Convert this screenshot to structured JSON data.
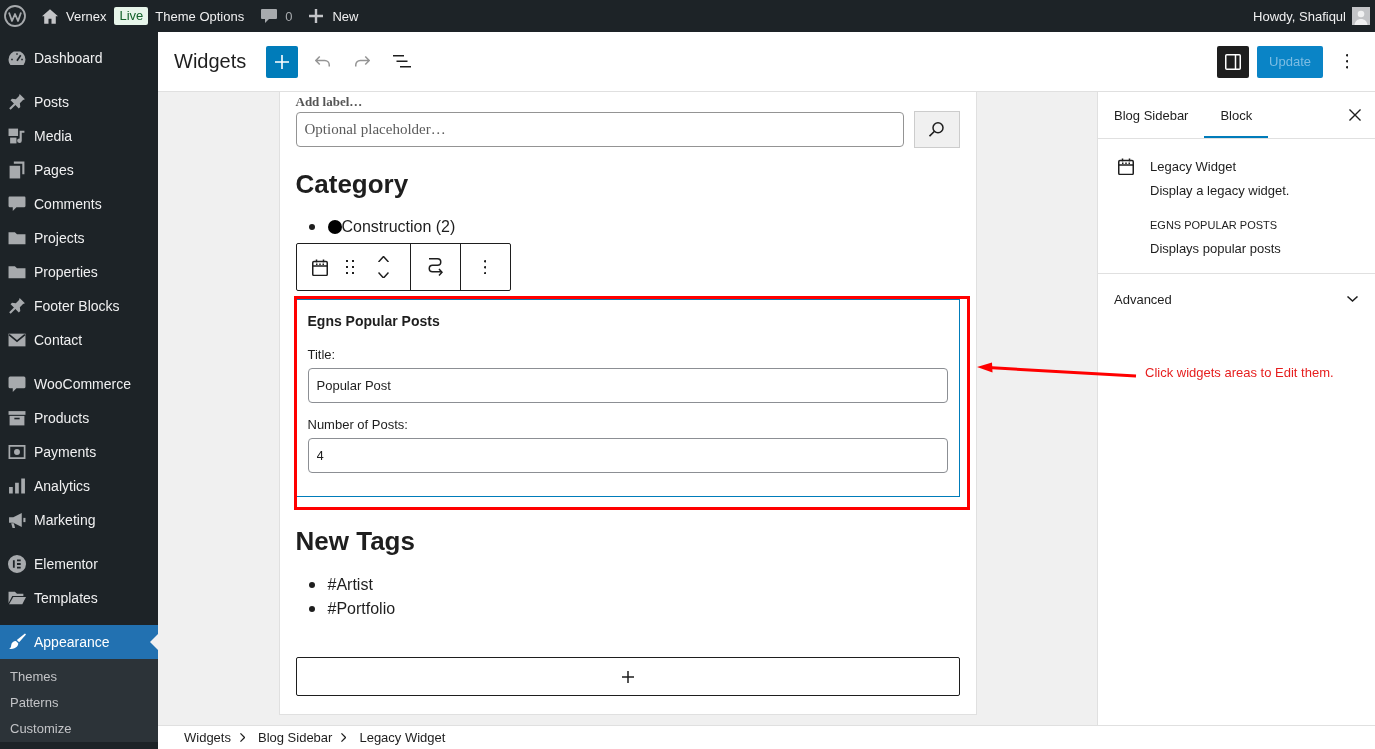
{
  "admin_bar": {
    "site_name": "Vernex",
    "badge": "Live",
    "menu_link": "Theme Options",
    "comment_count": "0",
    "new_label": "New",
    "greeting": "Howdy, Shafiqul"
  },
  "sidebar": {
    "groups": [
      {
        "items": [
          {
            "label": "Dashboard",
            "selected": false
          }
        ]
      },
      {
        "items": [
          {
            "label": "Posts",
            "selected": false
          },
          {
            "label": "Media",
            "selected": false
          },
          {
            "label": "Pages",
            "selected": false
          },
          {
            "label": "Comments",
            "selected": false
          },
          {
            "label": "Projects",
            "selected": false
          },
          {
            "label": "Properties",
            "selected": false
          },
          {
            "label": "Footer Blocks",
            "selected": false
          },
          {
            "label": "Contact",
            "selected": false
          }
        ]
      },
      {
        "items": [
          {
            "label": "WooCommerce",
            "selected": false
          },
          {
            "label": "Products",
            "selected": false
          },
          {
            "label": "Payments",
            "selected": false
          },
          {
            "label": "Analytics",
            "selected": false
          },
          {
            "label": "Marketing",
            "selected": false
          }
        ]
      },
      {
        "items": [
          {
            "label": "Elementor",
            "selected": false
          },
          {
            "label": "Templates",
            "selected": false
          }
        ]
      },
      {
        "items": [
          {
            "label": "Appearance",
            "selected": true,
            "children": [
              {
                "label": "Themes",
                "selected": false
              },
              {
                "label": "Patterns",
                "selected": false
              },
              {
                "label": "Customize",
                "selected": false
              }
            ]
          }
        ]
      }
    ]
  },
  "editor_header": {
    "title": "Widgets",
    "sidebar_toggle": {
      "on": true
    },
    "update_button": {
      "label": "Update",
      "disabled": true
    }
  },
  "canvas": {
    "search_block": {
      "label": "Add label…",
      "placeholder": "Optional placeholder…"
    },
    "category_block": {
      "heading": "Category",
      "items": [
        "Construction (2)"
      ]
    },
    "legacy_widget": {
      "selected": true,
      "title": "Egns Popular Posts",
      "fields": [
        {
          "label": "Title:",
          "value": "Popular Post"
        },
        {
          "label": "Number of Posts:",
          "value": "4"
        }
      ]
    },
    "tags_block": {
      "heading": "New Tags",
      "items": [
        "#Artist",
        "#Portfolio"
      ]
    }
  },
  "annotation": {
    "text": "Click widgets areas to Edit them."
  },
  "settings_sidebar": {
    "tabs": [
      {
        "label": "Blog Sidebar",
        "selected": false
      },
      {
        "label": "Block",
        "selected": true
      }
    ],
    "block_card": {
      "title": "Legacy Widget",
      "description": "Display a legacy widget.",
      "widget_name": "EGNS POPULAR POSTS",
      "widget_description": "Displays popular posts"
    },
    "panels": [
      {
        "title": "Advanced",
        "expanded": false
      }
    ]
  },
  "breadcrumbs": [
    "Widgets",
    "Blog Sidebar",
    "Legacy Widget"
  ]
}
